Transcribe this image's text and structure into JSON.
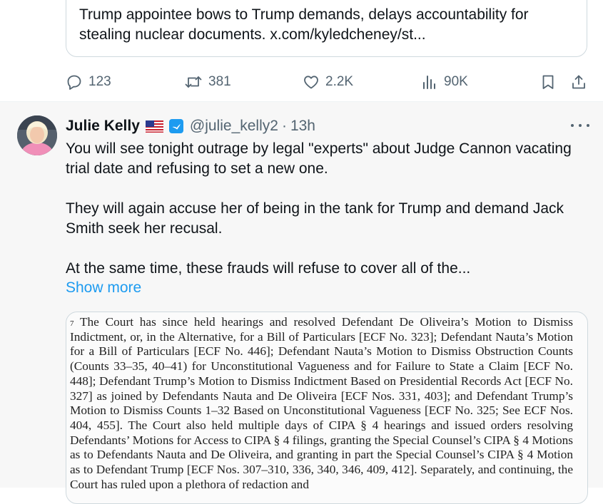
{
  "quoted_tweet": {
    "text": "Trump appointee bows to Trump demands, delays accountability for stealing nuclear documents. x.com/kyledcheney/st..."
  },
  "actions": {
    "replies": "123",
    "reposts": "381",
    "likes": "2.2K",
    "views": "90K"
  },
  "tweet": {
    "author_name": "Julie Kelly",
    "handle": "@julie_kelly2",
    "separator": "·",
    "time": "13h",
    "paragraphs": [
      "You will see tonight outrage by legal \"experts\" about Judge Cannon vacating trial date and refusing to set a new one.",
      "They will again accuse her of being in the tank for Trump and demand Jack Smith seek her recusal.",
      "At the same time, these frauds will refuse to cover all of the..."
    ],
    "show_more": "Show more"
  },
  "document": {
    "footnote_mark": "7",
    "text": "The Court has since held hearings and resolved Defendant De Oliveira’s Motion to Dismiss Indictment, or, in the Alternative, for a Bill of Particulars [ECF No. 323]; Defendant Nauta’s Motion for a Bill of Particulars [ECF No. 446]; Defendant Nauta’s Motion to Dismiss Obstruction Counts (Counts 33–35, 40–41) for Unconstitutional Vagueness and for Failure to State a Claim [ECF No. 448]; Defendant Trump’s Motion to Dismiss Indictment Based on Presidential Records Act [ECF No. 327] as joined by Defendants Nauta and De Oliveira [ECF Nos. 331, 403]; and Defendant Trump’s Motion to Dismiss Counts 1–32 Based on Unconstitutional Vagueness [ECF No. 325; See ECF Nos. 404, 455]. The Court also held multiple days of CIPA § 4 hearings and issued orders resolving Defendants’ Motions for Access to CIPA § 4 filings, granting the Special Counsel’s CIPA § 4 Motions as to Defendants Nauta and De Oliveira, and granting in part the Special Counsel’s CIPA § 4 Motion as to Defendant Trump [ECF Nos. 307–310, 336, 340, 346, 409, 412]. Separately, and continuing, the Court has ruled upon a plethora of redaction and"
  },
  "colors": {
    "text": "#0f1419",
    "secondary": "#536471",
    "link": "#1d9bf0",
    "border": "#cfd9de"
  },
  "icons": [
    "reply-icon",
    "repost-icon",
    "like-icon",
    "views-icon",
    "bookmark-icon",
    "share-icon",
    "us-flag-icon",
    "verified-badge-icon",
    "more-options-icon"
  ]
}
